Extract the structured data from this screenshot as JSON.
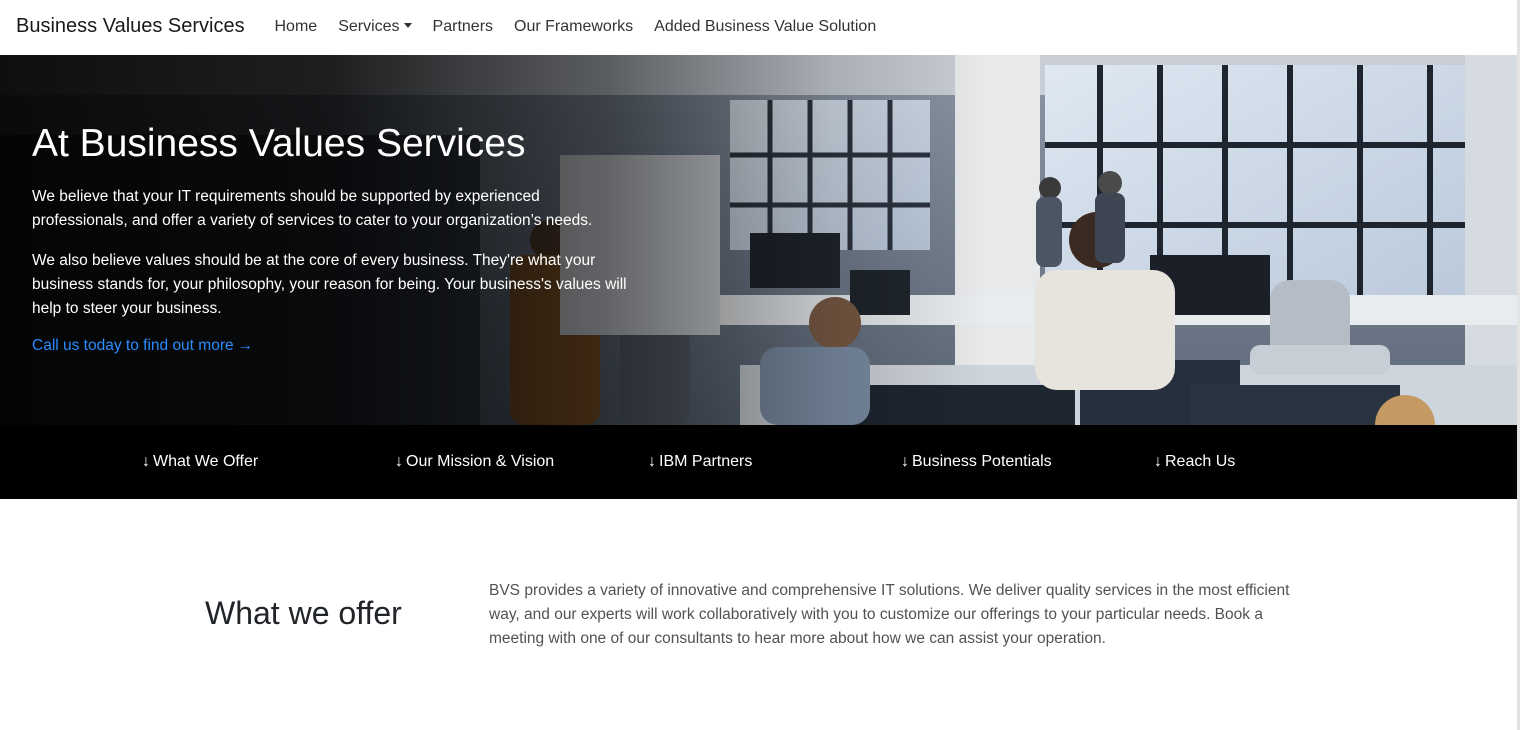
{
  "navbar": {
    "brand": "Business Values Services",
    "items": [
      {
        "label": "Home"
      },
      {
        "label": "Services",
        "has_dropdown": true
      },
      {
        "label": "Partners"
      },
      {
        "label": "Our Frameworks"
      },
      {
        "label": "Added Business Value Solution"
      }
    ]
  },
  "hero": {
    "title": "At Business Values Services",
    "paragraph1": "We believe that your IT requirements should be supported by experienced professionals, and offer a variety of services to cater to your organization’s needs.",
    "paragraph2": "We also believe values should be at the core of every business. They're what your business stands for, your philosophy, your reason for being. Your business's values will help to steer your business.",
    "cta_label": "Call us today to find out more",
    "cta_arrow": "→"
  },
  "anchors": {
    "arrow": "↓",
    "items": [
      {
        "label": "What We Offer"
      },
      {
        "label": "Our Mission & Vision"
      },
      {
        "label": "IBM Partners"
      },
      {
        "label": "Business Potentials"
      },
      {
        "label": "Reach Us"
      }
    ]
  },
  "offer": {
    "title": "What we offer",
    "text": "BVS provides a variety of innovative and comprehensive IT solutions. We deliver quality services in the most efficient way, and our experts will work collaboratively with you to customize our offerings to your particular needs. Book a meeting with one of our consultants to hear more about how we can assist your operation."
  },
  "colors": {
    "link": "#2a8cff",
    "anchor_bar": "#000000",
    "hero_text": "#ffffff"
  }
}
